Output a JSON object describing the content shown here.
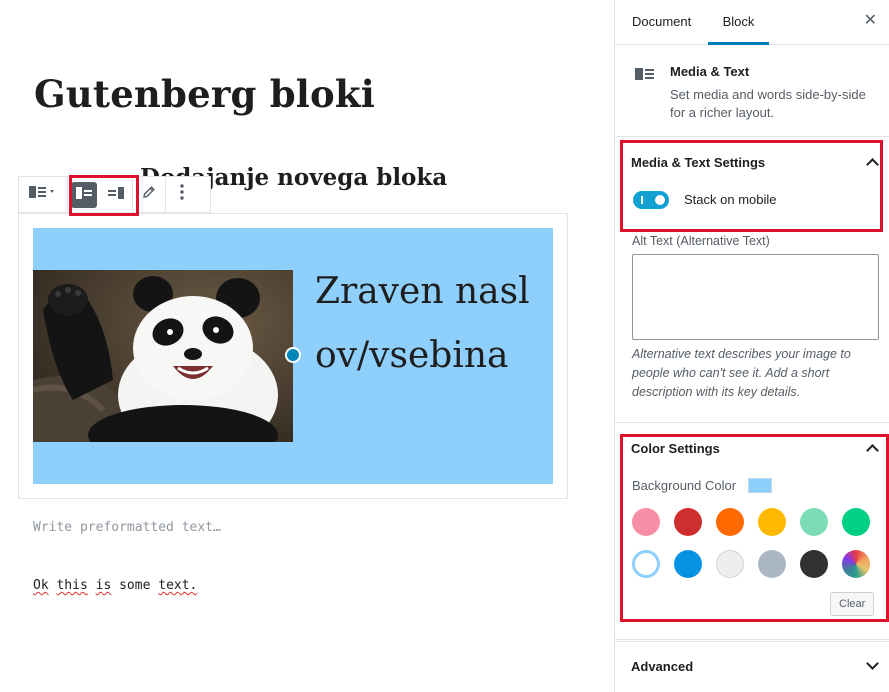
{
  "editor": {
    "title": "Gutenberg bloki",
    "heading": "Dodajanje novega bloka",
    "media_text_content": "Zraven naslov/vsebina",
    "preformatted_placeholder": "Write preformatted text…",
    "preformatted_words": [
      "Ok",
      "this",
      "is",
      "some",
      "text."
    ],
    "media_background": "#8ecffb"
  },
  "toolbar": {
    "transform_icon": "media-text-icon",
    "position_buttons": [
      {
        "name": "media-left-icon",
        "active": true
      },
      {
        "name": "media-right-icon",
        "active": false
      }
    ],
    "edit_icon": "pencil-icon",
    "more_icon": "more-vertical-icon"
  },
  "sidebar": {
    "tabs": [
      "Document",
      "Block"
    ],
    "active_tab": "Block",
    "close_icon": "close-icon",
    "block_card": {
      "title": "Media & Text",
      "description": "Set media and words side-by-side for a richer layout."
    },
    "settings_panel": {
      "title": "Media & Text Settings",
      "toggle_label": "Stack on mobile",
      "toggle_on": true,
      "alt_label": "Alt Text (Alternative Text)",
      "alt_value": "",
      "alt_help": "Alternative text describes your image to people who can't see it. Add a short description with its key details."
    },
    "color_panel": {
      "title": "Color Settings",
      "background_label": "Background Color",
      "current_color": "#8ecffb",
      "palette": [
        "#f78da7",
        "#cf2e2e",
        "#ff6900",
        "#fcb900",
        "#7bdcb5",
        "#00d084",
        "#ffffff",
        "#0693e3",
        "#eeeeee",
        "#abb8c3",
        "#313131",
        "gradient"
      ],
      "clear_label": "Clear"
    },
    "advanced_panel": {
      "title": "Advanced"
    }
  }
}
